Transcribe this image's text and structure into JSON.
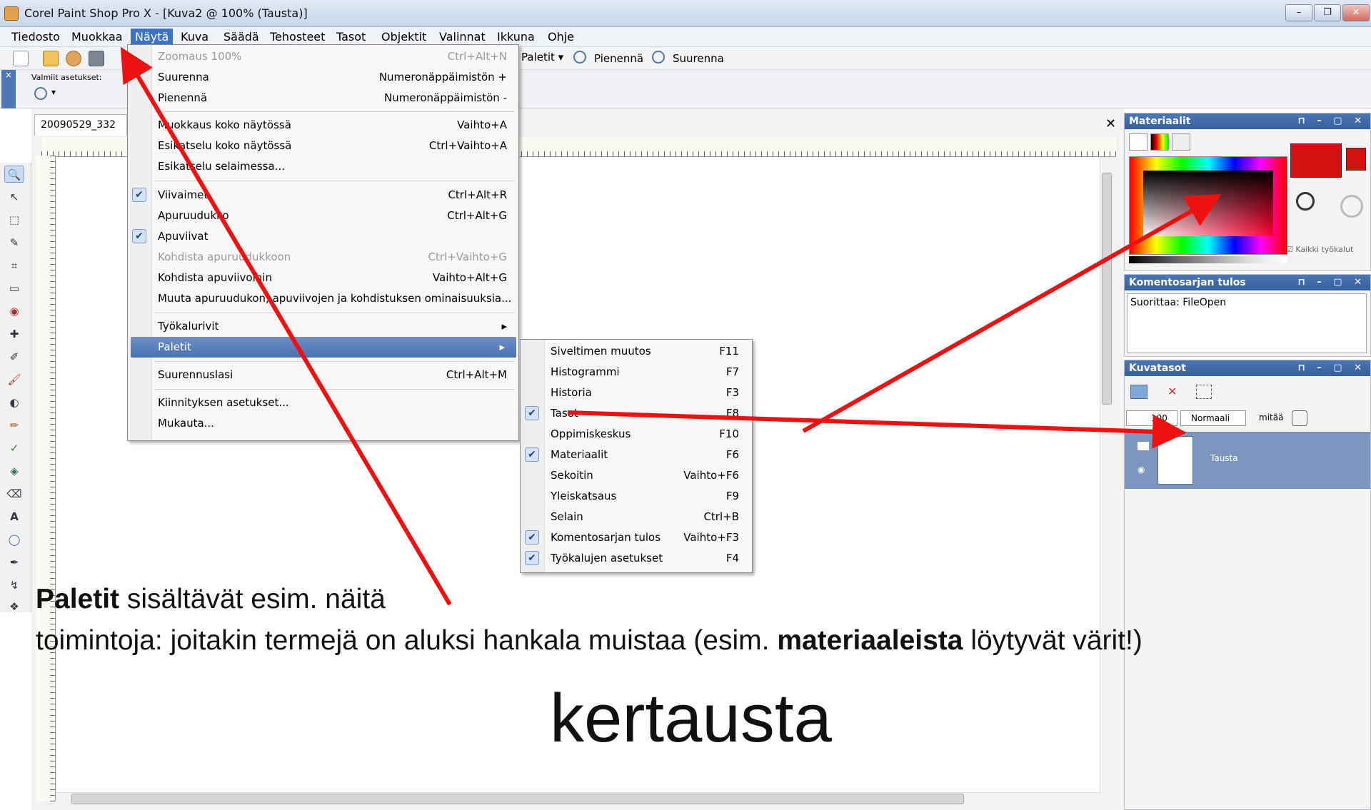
{
  "window": {
    "title": "Corel Paint Shop Pro X - [Kuva2 @ 100% (Tausta)]",
    "controls": [
      "–",
      "❐",
      "✕"
    ]
  },
  "menubar": [
    "Tiedosto",
    "Muokkaa",
    "Näytä",
    "Kuva",
    "Säädä",
    "Tehosteet",
    "Tasot",
    "Objektit",
    "Valinnat",
    "Ikkuna",
    "Ohje"
  ],
  "toolbar": {
    "paletit": "Paletit",
    "pienenna": "Pienennä",
    "suurenna": "Suurenna"
  },
  "toolbar2": {
    "presets_label": "Valmiit asetukset:"
  },
  "document": {
    "tab": "20090529_332 @"
  },
  "nayta_menu": [
    {
      "label": "Zoomaus 100%",
      "shortcut": "Ctrl+Alt+N",
      "disabled": true
    },
    {
      "label": "Suurenna",
      "shortcut": "Numeronäppäimistön +"
    },
    {
      "label": "Pienennä",
      "shortcut": "Numeronäppäimistön -"
    },
    {
      "label": "Muokkaus koko näytössä",
      "shortcut": "Vaihto+A"
    },
    {
      "label": "Esikatselu koko näytössä",
      "shortcut": "Ctrl+Vaihto+A"
    },
    {
      "label": "Esikatselu selaimessa...",
      "shortcut": ""
    },
    {
      "label": "Viivaimet",
      "shortcut": "Ctrl+Alt+R",
      "checked": true
    },
    {
      "label": "Apuruudukko",
      "shortcut": "Ctrl+Alt+G"
    },
    {
      "label": "Apuviivat",
      "shortcut": "",
      "checked": true
    },
    {
      "label": "Kohdista apuruudukkoon",
      "shortcut": "Ctrl+Vaihto+G",
      "disabled": true
    },
    {
      "label": "Kohdista apuviivoihin",
      "shortcut": "Vaihto+Alt+G"
    },
    {
      "label": "Muuta apuruudukon, apuviivojen ja kohdistuksen ominaisuuksia...",
      "shortcut": ""
    },
    {
      "label": "Työkalurivit",
      "shortcut": "▸"
    },
    {
      "label": "Paletit",
      "shortcut": "▸",
      "highlighted": true
    },
    {
      "label": "Suurennuslasi",
      "shortcut": "Ctrl+Alt+M"
    },
    {
      "label": "Kiinnityksen asetukset...",
      "shortcut": ""
    },
    {
      "label": "Mukauta...",
      "shortcut": ""
    }
  ],
  "paletit_submenu": [
    {
      "label": "Siveltimen muutos",
      "shortcut": "F11"
    },
    {
      "label": "Histogrammi",
      "shortcut": "F7"
    },
    {
      "label": "Historia",
      "shortcut": "F3"
    },
    {
      "label": "Tasot",
      "shortcut": "F8",
      "checked": true
    },
    {
      "label": "Oppimiskeskus",
      "shortcut": "F10"
    },
    {
      "label": "Materiaalit",
      "shortcut": "F6",
      "checked": true
    },
    {
      "label": "Sekoitin",
      "shortcut": "Vaihto+F6"
    },
    {
      "label": "Yleiskatsaus",
      "shortcut": "F9"
    },
    {
      "label": "Selain",
      "shortcut": "Ctrl+B"
    },
    {
      "label": "Komentosarjan tulos",
      "shortcut": "Vaihto+F3",
      "checked": true
    },
    {
      "label": "Työkalujen asetukset",
      "shortcut": "F4",
      "checked": true
    }
  ],
  "panels": {
    "materiaalit": {
      "title": "Materiaalit",
      "all_tools": "Kaikki työkalut",
      "fg_color": "#d41010"
    },
    "komentosarja": {
      "title": "Komentosarjan tulos",
      "content": "Suorittaa: FileOpen"
    },
    "kuvatasot": {
      "title": "Kuvatasot",
      "opacity": "100",
      "blend": "Normaali",
      "extra": "mitää",
      "layer": "Tausta"
    }
  },
  "annotation": {
    "line1_bold": "Paletit",
    "line1_rest": " sisältävät esim. näitä",
    "line2_a": "toimintoja:  joitakin termejä on aluksi hankala muistaa (esim. ",
    "line2_bold": "materiaaleista",
    "line2_b": " löytyvät värit!)",
    "big": "kertausta"
  },
  "colors": {
    "accent": "#3c73c4",
    "arrow": "#ee1111",
    "layer_panel": "#7d96c0"
  }
}
